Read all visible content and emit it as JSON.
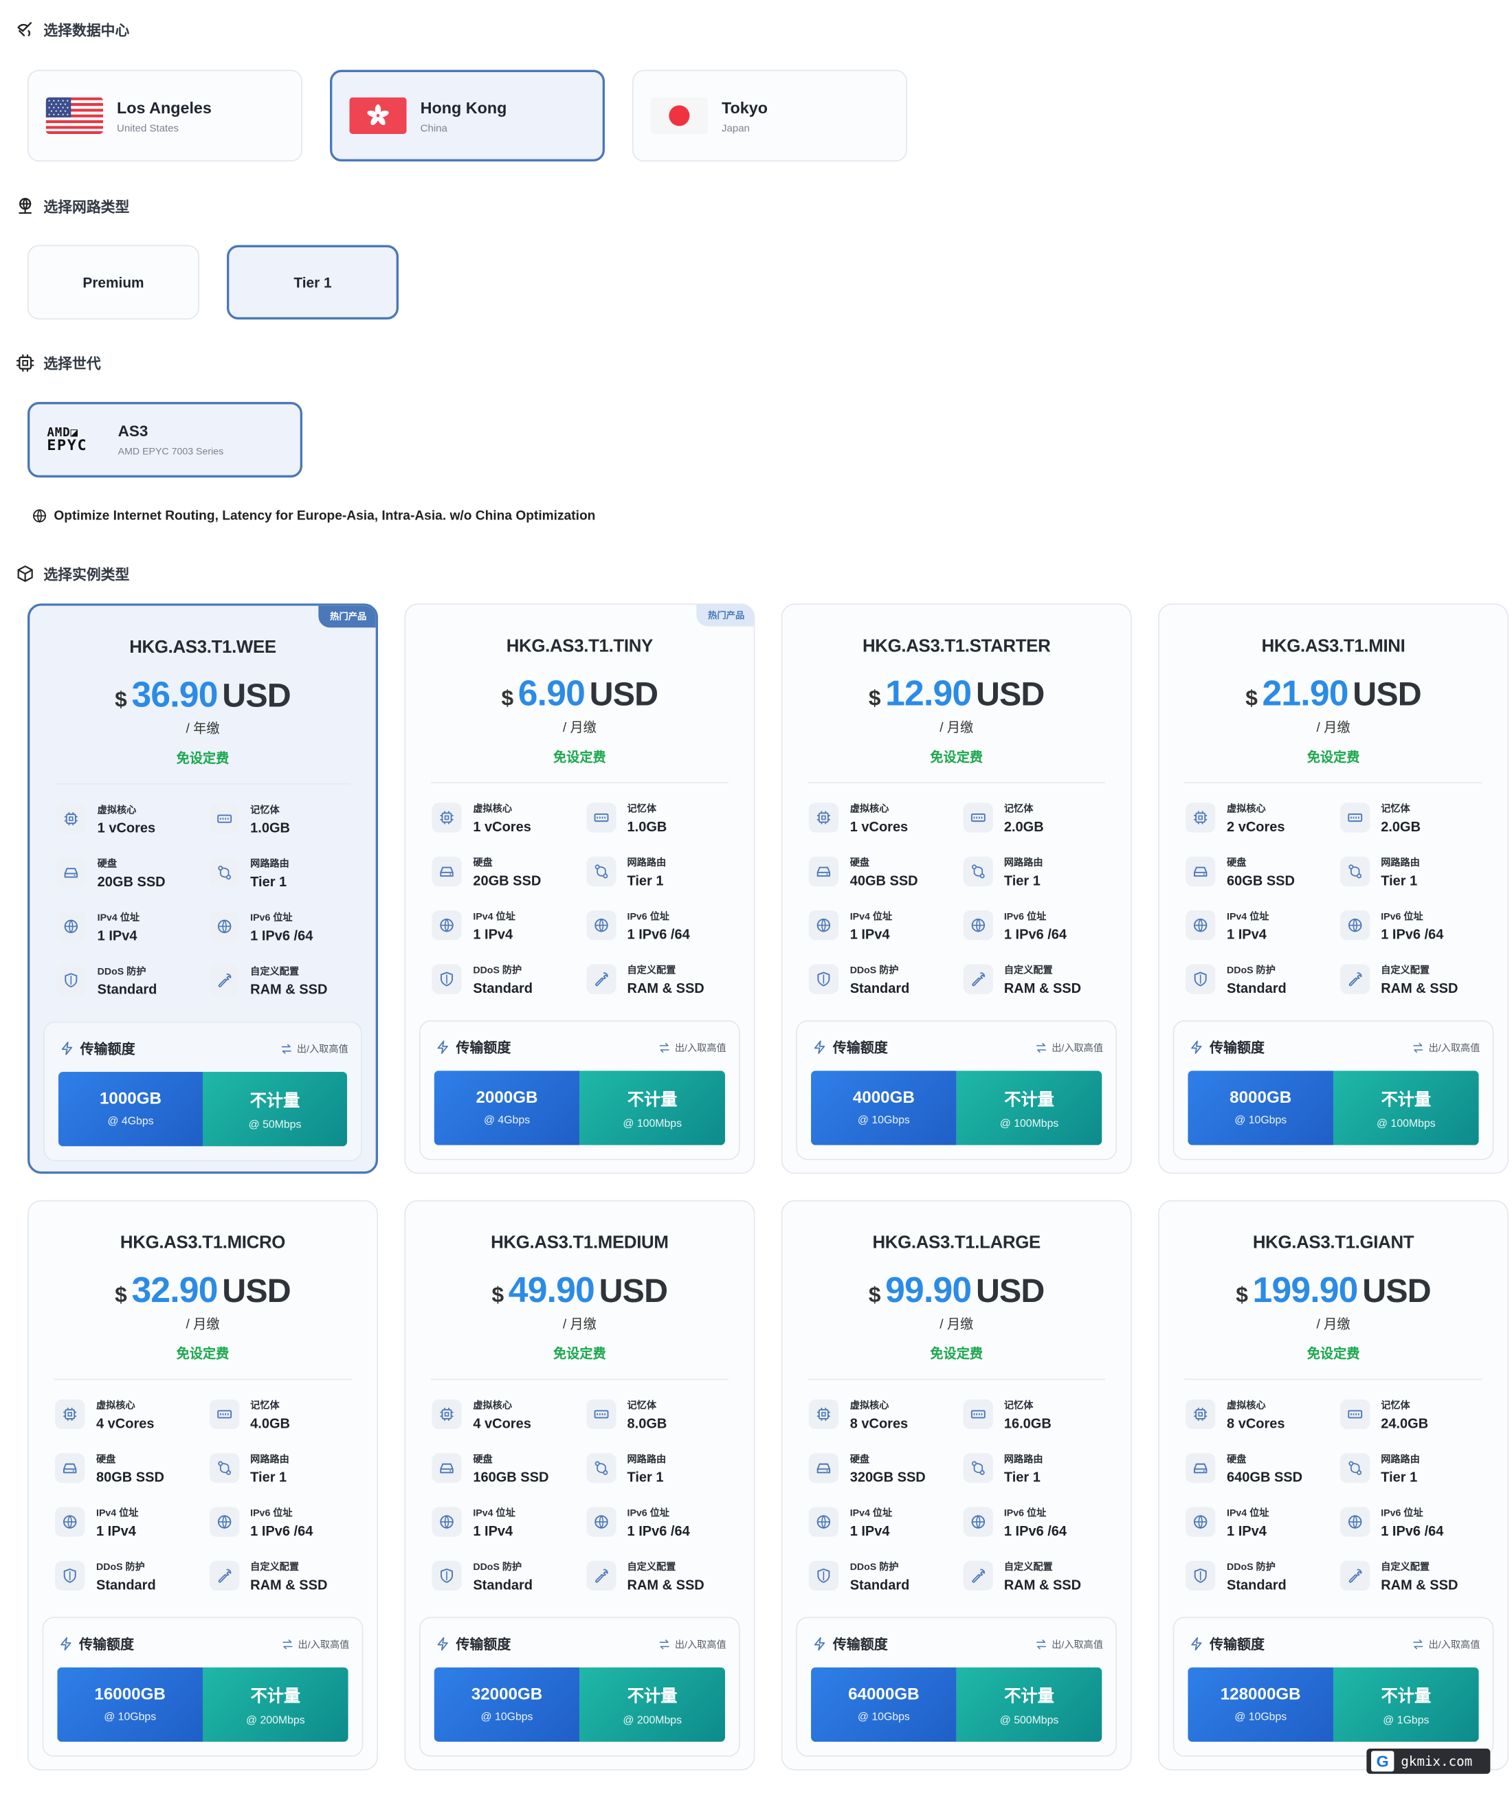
{
  "sections": {
    "datacenter": "选择数据中心",
    "network": "选择网路类型",
    "generation": "选择世代",
    "instance": "选择实例类型"
  },
  "datacenters": [
    {
      "name": "Los Angeles",
      "country": "United States",
      "flag": "us-flag",
      "selected": false
    },
    {
      "name": "Hong Kong",
      "country": "China",
      "flag": "hk-flag",
      "selected": true
    },
    {
      "name": "Tokyo",
      "country": "Japan",
      "flag": "jp-flag",
      "selected": false
    }
  ],
  "networks": [
    {
      "label": "Premium",
      "selected": false
    },
    {
      "label": "Tier 1",
      "selected": true
    }
  ],
  "generation": {
    "logo": "AMD EPYC",
    "name": "AS3",
    "desc": "AMD EPYC 7003 Series",
    "selected": true
  },
  "optimize_note": "Optimize Internet Routing, Latency for Europe-Asia, Intra-Asia. w/o China Optimization",
  "labels": {
    "currency": "$",
    "currency_unit": "USD",
    "no_setup": "免设定费",
    "hot": "热门产品",
    "vcpu": "虚拟核心",
    "memory": "记忆体",
    "disk": "硬盘",
    "route": "网路路由",
    "ipv4": "IPv4 位址",
    "ipv6": "IPv6 位址",
    "ddos": "DDoS 防护",
    "custom": "自定义配置",
    "transfer": "传输额度",
    "transfer_hint": "出/入取高值",
    "unmetered": "不计量"
  },
  "plans": [
    {
      "name": "HKG.AS3.T1.WEE",
      "price": "36.90",
      "period": "/ 年缴",
      "hot": true,
      "selected": true,
      "vcpu": "1 vCores",
      "memory": "1.0GB",
      "disk": "20GB SSD",
      "route": "Tier 1",
      "ipv4": "1 IPv4",
      "ipv6": "1 IPv6 /64",
      "ddos": "Standard",
      "custom": "RAM & SSD",
      "transfer": "1000GB",
      "transfer_speed": "@ 4Gbps",
      "unmetered_speed": "@ 50Mbps"
    },
    {
      "name": "HKG.AS3.T1.TINY",
      "price": "6.90",
      "period": "/ 月缴",
      "hot": true,
      "selected": false,
      "vcpu": "1 vCores",
      "memory": "1.0GB",
      "disk": "20GB SSD",
      "route": "Tier 1",
      "ipv4": "1 IPv4",
      "ipv6": "1 IPv6 /64",
      "ddos": "Standard",
      "custom": "RAM & SSD",
      "transfer": "2000GB",
      "transfer_speed": "@ 4Gbps",
      "unmetered_speed": "@ 100Mbps"
    },
    {
      "name": "HKG.AS3.T1.STARTER",
      "price": "12.90",
      "period": "/ 月缴",
      "hot": false,
      "selected": false,
      "vcpu": "1 vCores",
      "memory": "2.0GB",
      "disk": "40GB SSD",
      "route": "Tier 1",
      "ipv4": "1 IPv4",
      "ipv6": "1 IPv6 /64",
      "ddos": "Standard",
      "custom": "RAM & SSD",
      "transfer": "4000GB",
      "transfer_speed": "@ 10Gbps",
      "unmetered_speed": "@ 100Mbps"
    },
    {
      "name": "HKG.AS3.T1.MINI",
      "price": "21.90",
      "period": "/ 月缴",
      "hot": false,
      "selected": false,
      "vcpu": "2 vCores",
      "memory": "2.0GB",
      "disk": "60GB SSD",
      "route": "Tier 1",
      "ipv4": "1 IPv4",
      "ipv6": "1 IPv6 /64",
      "ddos": "Standard",
      "custom": "RAM & SSD",
      "transfer": "8000GB",
      "transfer_speed": "@ 10Gbps",
      "unmetered_speed": "@ 100Mbps"
    },
    {
      "name": "HKG.AS3.T1.MICRO",
      "price": "32.90",
      "period": "/ 月缴",
      "hot": false,
      "selected": false,
      "vcpu": "4 vCores",
      "memory": "4.0GB",
      "disk": "80GB SSD",
      "route": "Tier 1",
      "ipv4": "1 IPv4",
      "ipv6": "1 IPv6 /64",
      "ddos": "Standard",
      "custom": "RAM & SSD",
      "transfer": "16000GB",
      "transfer_speed": "@ 10Gbps",
      "unmetered_speed": "@ 200Mbps"
    },
    {
      "name": "HKG.AS3.T1.MEDIUM",
      "price": "49.90",
      "period": "/ 月缴",
      "hot": false,
      "selected": false,
      "vcpu": "4 vCores",
      "memory": "8.0GB",
      "disk": "160GB SSD",
      "route": "Tier 1",
      "ipv4": "1 IPv4",
      "ipv6": "1 IPv6 /64",
      "ddos": "Standard",
      "custom": "RAM & SSD",
      "transfer": "32000GB",
      "transfer_speed": "@ 10Gbps",
      "unmetered_speed": "@ 200Mbps"
    },
    {
      "name": "HKG.AS3.T1.LARGE",
      "price": "99.90",
      "period": "/ 月缴",
      "hot": false,
      "selected": false,
      "vcpu": "8 vCores",
      "memory": "16.0GB",
      "disk": "320GB SSD",
      "route": "Tier 1",
      "ipv4": "1 IPv4",
      "ipv6": "1 IPv6 /64",
      "ddos": "Standard",
      "custom": "RAM & SSD",
      "transfer": "64000GB",
      "transfer_speed": "@ 10Gbps",
      "unmetered_speed": "@ 500Mbps"
    },
    {
      "name": "HKG.AS3.T1.GIANT",
      "price": "199.90",
      "period": "/ 月缴",
      "hot": false,
      "selected": false,
      "vcpu": "8 vCores",
      "memory": "24.0GB",
      "disk": "640GB SSD",
      "route": "Tier 1",
      "ipv4": "1 IPv4",
      "ipv6": "1 IPv6 /64",
      "ddos": "Standard",
      "custom": "RAM & SSD",
      "transfer": "128000GB",
      "transfer_speed": "@ 10Gbps",
      "unmetered_speed": "@ 1Gbps"
    }
  ],
  "watermark": {
    "logo": "G",
    "text": "gkmix.com"
  },
  "colors": {
    "accent": "#4a78b8",
    "price": "#2b8be6",
    "free": "#1aa84d",
    "transfer_blue": "#2f7fe8",
    "transfer_teal": "#1fb8a7"
  }
}
